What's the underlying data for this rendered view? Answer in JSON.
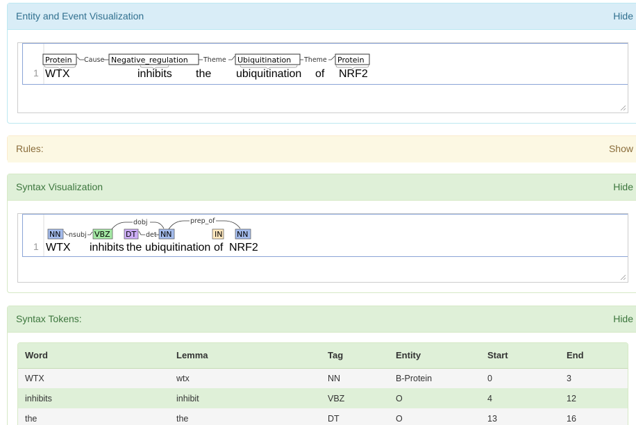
{
  "entity_panel": {
    "title": "Entity and Event Visualization",
    "toggle": "Hide",
    "line_number": "1",
    "tokens": [
      "WTX",
      "inhibits",
      "the",
      "ubiquitination",
      "of",
      "NRF2"
    ],
    "labels": [
      "Protein",
      "Negative_regulation",
      "Ubiquitination",
      "Protein"
    ],
    "arcs": [
      "Cause",
      "Theme",
      "Theme"
    ]
  },
  "rules_panel": {
    "title": "Rules:",
    "toggle": "Show"
  },
  "syntax_panel": {
    "title": "Syntax Visualization",
    "toggle": "Hide",
    "line_number": "1",
    "tokens": [
      "WTX",
      "inhibits",
      "the",
      "ubiquitination",
      "of",
      "NRF2"
    ],
    "tags": [
      "NN",
      "VBZ",
      "DT",
      "NN",
      "IN",
      "NN"
    ],
    "arcs": [
      "nsubj",
      "dobj",
      "det",
      "prep_of"
    ],
    "tag_colors": {
      "NN": "#a4bced",
      "VBZ": "#a4e8a4",
      "DT": "#ccadf6",
      "IN": "#ffe8be"
    }
  },
  "tokens_panel": {
    "title": "Syntax Tokens:",
    "toggle": "Hide",
    "columns": [
      "Word",
      "Lemma",
      "Tag",
      "Entity",
      "Start",
      "End"
    ],
    "rows": [
      [
        "WTX",
        "wtx",
        "NN",
        "B-Protein",
        "0",
        "3"
      ],
      [
        "inhibits",
        "inhibit",
        "VBZ",
        "O",
        "4",
        "12"
      ],
      [
        "the",
        "the",
        "DT",
        "O",
        "13",
        "16"
      ]
    ]
  }
}
